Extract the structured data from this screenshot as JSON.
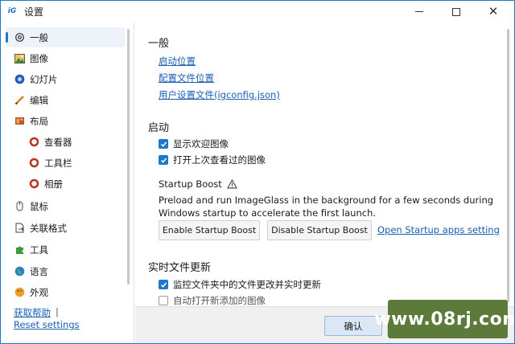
{
  "window": {
    "title": "设置",
    "icon": "imageglass-app-icon",
    "controls": [
      "minimize-icon",
      "maximize-icon",
      "close-icon"
    ]
  },
  "sidebar": {
    "items": [
      {
        "label": "一般",
        "icon": "gear-icon",
        "active": true
      },
      {
        "label": "图像",
        "icon": "image-icon"
      },
      {
        "label": "幻灯片",
        "icon": "slideshow-icon"
      },
      {
        "label": "编辑",
        "icon": "pencil-icon"
      },
      {
        "label": "布局",
        "icon": "layout-icon"
      },
      {
        "label": "查看器",
        "icon": "ring-icon",
        "sub": true
      },
      {
        "label": "工具栏",
        "icon": "ring-icon",
        "sub": true
      },
      {
        "label": "相册",
        "icon": "ring-icon",
        "sub": true
      },
      {
        "label": "鼠标",
        "icon": "mouse-icon"
      },
      {
        "label": "关联格式",
        "icon": "file-association-icon"
      },
      {
        "label": "工具",
        "icon": "puzzle-icon"
      },
      {
        "label": "语言",
        "icon": "globe-icon"
      },
      {
        "label": "外观",
        "icon": "appearance-icon"
      }
    ],
    "footer": {
      "help": "获取帮助",
      "separator": "|",
      "reset": "Reset settings"
    }
  },
  "main": {
    "general": {
      "title": "一般",
      "links": [
        "启动位置",
        "配置文件位置",
        "用户设置文件(igconfig.json)"
      ]
    },
    "startup": {
      "title": "启动",
      "checks": [
        {
          "label": "显示欢迎图像",
          "checked": true
        },
        {
          "label": "打开上次查看过的图像",
          "checked": true
        }
      ],
      "boost_title": "Startup Boost",
      "boost_desc": "Preload and run ImageGlass in the background for a few seconds during Windows startup to accelerate the first launch.",
      "enable_label": "Enable Startup Boost",
      "disable_label": "Disable Startup Boost",
      "apps_link": "Open Startup apps setting"
    },
    "realtime": {
      "title": "实时文件更新",
      "checks": [
        {
          "label": "监控文件夹中的文件更改并实时更新",
          "checked": true
        },
        {
          "label": "自动打开新添加的图像",
          "checked": false
        }
      ]
    }
  },
  "footer": {
    "ok_label": "确认"
  },
  "watermark": {
    "text": "www.08rj.com"
  },
  "colors": {
    "accent": "#1e78c8",
    "link": "#1a5fb4",
    "watermark_bg": "#5c7a3a"
  }
}
